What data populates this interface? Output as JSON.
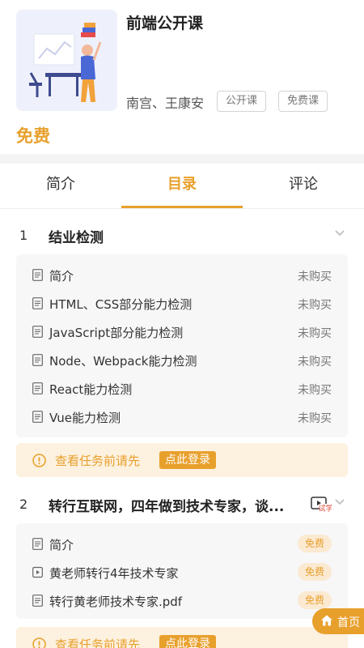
{
  "course": {
    "title": "前端公开课",
    "teachers": "南宫、王康安",
    "tags": [
      "公开课",
      "免费课"
    ],
    "price": "免费"
  },
  "tabs": [
    {
      "label": "简介",
      "active": false
    },
    {
      "label": "目录",
      "active": true
    },
    {
      "label": "评论",
      "active": false
    }
  ],
  "chapters": [
    {
      "number": "1",
      "title": "结业检测",
      "lessons": [
        {
          "title": "简介",
          "status": "未购买"
        },
        {
          "title": "HTML、CSS部分能力检测",
          "status": "未购买"
        },
        {
          "title": "JavaScript部分能力检测",
          "status": "未购买"
        },
        {
          "title": "Node、Webpack能力检测",
          "status": "未购买"
        },
        {
          "title": "React能力检测",
          "status": "未购买"
        },
        {
          "title": "Vue能力检测",
          "status": "未购买"
        }
      ],
      "login_prompt": {
        "text": "查看任务前请先",
        "button": "点此登录"
      }
    },
    {
      "number": "2",
      "title": "转行互联网，四年做到技术专家，谈...",
      "trial_badge": "试学",
      "lessons": [
        {
          "title": "简介",
          "status": "免费",
          "icon": "document-icon"
        },
        {
          "title": "黄老师转行4年技术专家",
          "status": "免费",
          "icon": "video-icon"
        },
        {
          "title": "转行黄老师技术专家.pdf",
          "status": "免费",
          "icon": "document-icon"
        }
      ],
      "login_prompt": {
        "text": "查看任务前请先",
        "button": "点此登录"
      }
    }
  ],
  "floating": {
    "home_label": "首页"
  },
  "colors": {
    "accent": "#e8a02c",
    "badge_bg": "#fbe9d2",
    "login_bg": "#fdf1df"
  }
}
